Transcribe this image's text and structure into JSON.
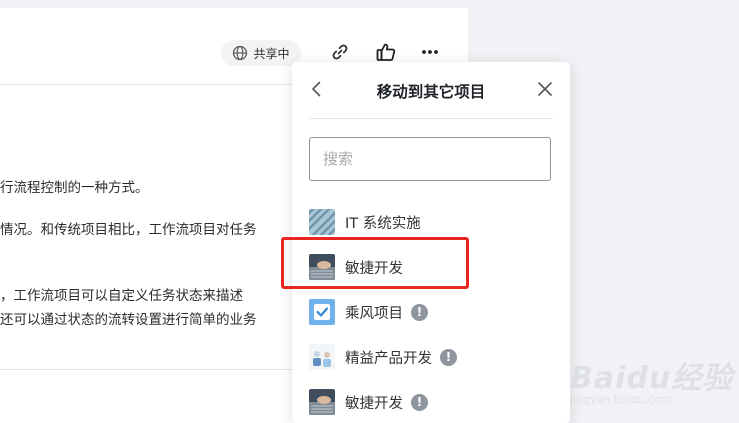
{
  "toolbar": {
    "share_status": "共享中",
    "link_icon": "link-icon",
    "like_icon": "thumbs-up-icon",
    "more_icon": "more-icon"
  },
  "document": {
    "lines": [
      "行流程控制的一种方式。",
      "情况。和传统项目相比，工作流项目对任务",
      "，工作流项目可以自定义任务状态来描述",
      "还可以通过状态的流转设置进行简单的业务"
    ]
  },
  "move_panel": {
    "title": "移动到其它项目",
    "search_placeholder": "搜索",
    "projects": [
      {
        "label": "IT 系统实施",
        "thumb": "striped-thumb",
        "info": ""
      },
      {
        "label": "敏捷开发",
        "thumb": "keyboard-photo-thumb",
        "info": ""
      },
      {
        "label": "乘风项目",
        "thumb": "checkbox-thumb",
        "info": "!"
      },
      {
        "label": "精益产品开发",
        "thumb": "people-photo-thumb",
        "info": "!"
      },
      {
        "label": "敏捷开发",
        "thumb": "keyboard-photo-thumb",
        "info": "!"
      }
    ]
  },
  "watermark": {
    "logo": "Baidu经验",
    "url": "jingyan.baidu.com"
  },
  "colors": {
    "highlight": "#e8261f",
    "panel_bg": "#ffffff",
    "page_bg": "#f1f2f5"
  }
}
